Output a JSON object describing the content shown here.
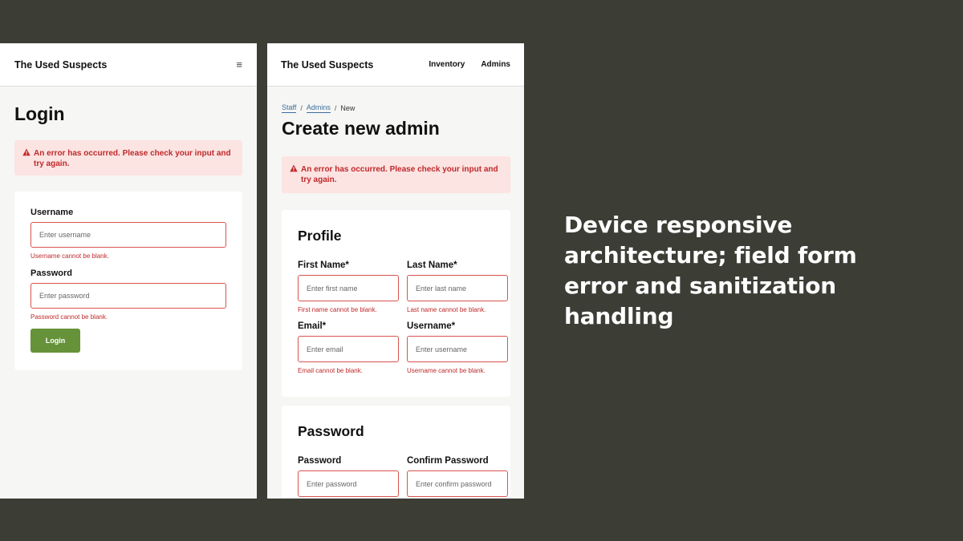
{
  "mobile": {
    "brand": "The Used Suspects",
    "menu_icon": "hamburger-icon",
    "title": "Login",
    "alert_text": "An error has occurred. Please check your input and try again.",
    "username_label": "Username",
    "username_placeholder": "Enter username",
    "username_error": "Username cannot be blank.",
    "password_label": "Password",
    "password_placeholder": "Enter password",
    "password_error": "Password cannot be blank.",
    "login_button": "Login",
    "button_color": "#66923a"
  },
  "desktop": {
    "brand": "The Used Suspects",
    "nav": [
      "Inventory",
      "Admins"
    ],
    "breadcrumb": [
      "Staff",
      "Admins",
      "New"
    ],
    "title": "Create new admin",
    "alert_text": "An error has occurred. Please check your input and try again.",
    "profile": {
      "heading": "Profile",
      "fields": [
        {
          "label": "First Name*",
          "placeholder": "Enter first name",
          "error": "First name cannot be blank."
        },
        {
          "label": "Last Name*",
          "placeholder": "Enter last name",
          "error": "Last name cannot be blank."
        },
        {
          "label": "Email*",
          "placeholder": "Enter email",
          "error": "Email cannot be blank."
        },
        {
          "label": "Username*",
          "placeholder": "Enter username",
          "error": "Username cannot be blank."
        }
      ]
    },
    "password": {
      "heading": "Password",
      "fields": [
        {
          "label": "Password",
          "placeholder": "Enter password"
        },
        {
          "label": "Confirm Password",
          "placeholder": "Enter confirm password"
        }
      ]
    }
  },
  "caption": "Device responsive architecture; field form error and sanitization handling",
  "colors": {
    "error": "#c0282a",
    "alert_bg": "#fbe4e2",
    "link": "#3d6f9e",
    "background": "#3c3e36"
  }
}
